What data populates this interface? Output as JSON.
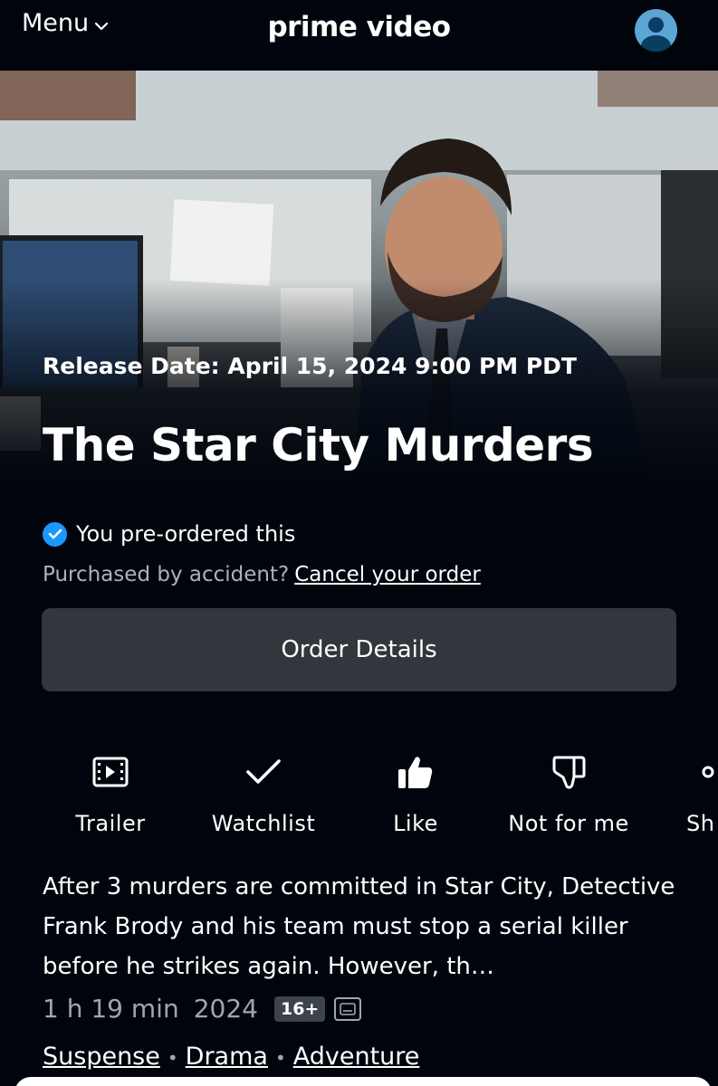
{
  "header": {
    "menu_label": "Menu",
    "logo_text": "prime video"
  },
  "hero": {
    "release_text": "Release Date: April 15, 2024 9:00 PM PDT",
    "title": "The Star City Murders"
  },
  "order": {
    "preordered_text": "You pre-ordered this",
    "accident_text": "Purchased by accident?",
    "cancel_link": "Cancel your order",
    "details_button": "Order Details"
  },
  "actions": [
    {
      "label": "Trailer",
      "icon": "trailer-icon"
    },
    {
      "label": "Watchlist",
      "icon": "checkmark-icon"
    },
    {
      "label": "Like",
      "icon": "thumbs-up-icon"
    },
    {
      "label": "Not for me",
      "icon": "thumbs-down-icon"
    },
    {
      "label": "Sh",
      "icon": "share-icon"
    }
  ],
  "details": {
    "synopsis": "After 3 murders are committed in Star City, Detective Frank Brody and his team must stop a serial killer before he strikes again. However, th…",
    "runtime": "1 h 19 min",
    "year": "2024",
    "rating": "16+",
    "genres": [
      "Suspense",
      "Drama",
      "Adventure"
    ]
  },
  "colors": {
    "background": "#00050d",
    "button": "#33373d",
    "accent": "#1a98ff",
    "muted_text": "#aab3bd"
  }
}
